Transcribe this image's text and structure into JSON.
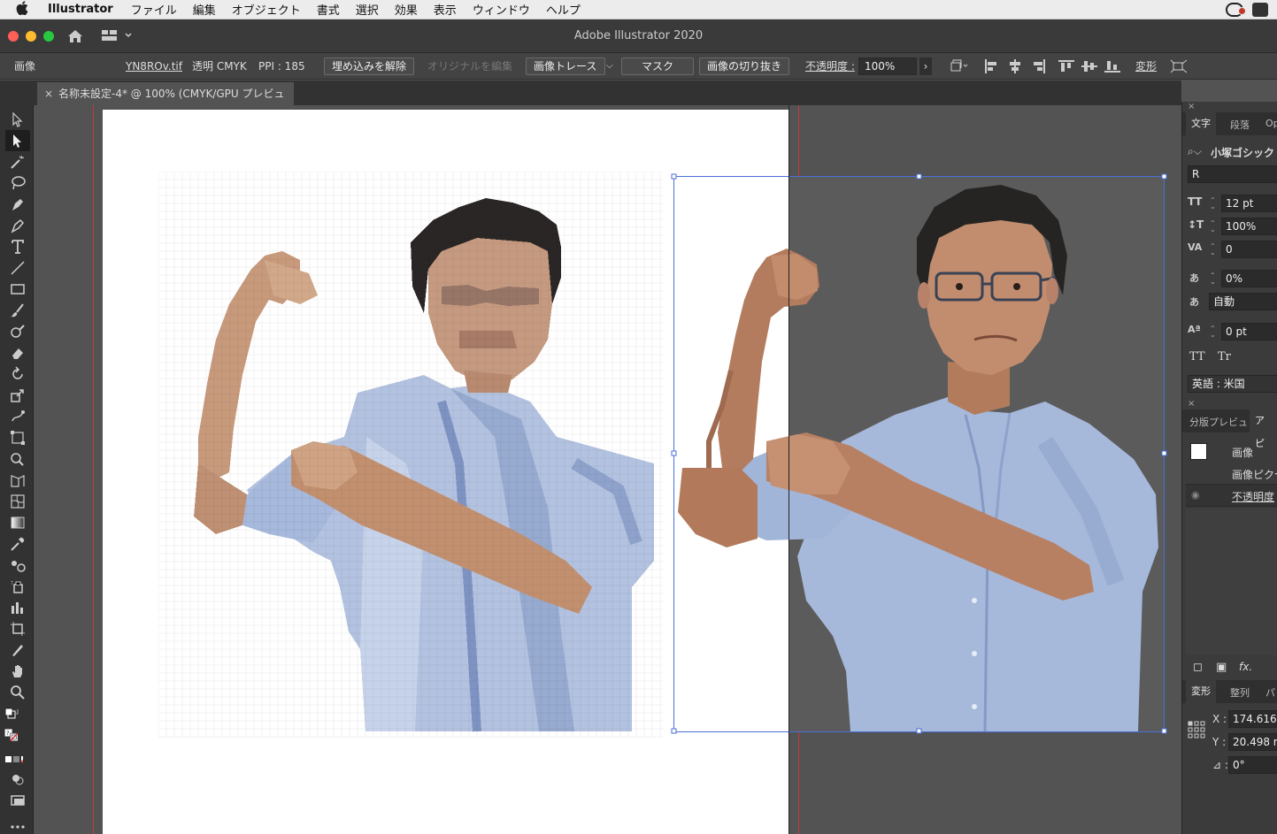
{
  "menubar": {
    "app_name": "Illustrator",
    "items": [
      "ファイル",
      "編集",
      "オブジェクト",
      "書式",
      "選択",
      "効果",
      "表示",
      "ウィンドウ",
      "ヘルプ"
    ]
  },
  "window": {
    "title": "Adobe Illustrator 2020"
  },
  "control_bar": {
    "object_type": "画像",
    "file_name": "YN8ROv.tif",
    "color_mode": "透明 CMYK",
    "ppi": "PPI : 185",
    "unembed_button": "埋め込みを解除",
    "edit_original_button": "オリジナルを編集",
    "image_trace_button": "画像トレース",
    "mask_button": "マスク",
    "crop_button": "画像の切り抜き",
    "opacity_label": "不透明度 :",
    "opacity_value": "100%",
    "transform_label": "変形"
  },
  "document_tab": {
    "close": "×",
    "label": "名称未設定-4* @ 100% (CMYK/GPU プレビュー)"
  },
  "character_panel": {
    "close": "×",
    "tabs": [
      "文字",
      "段落",
      "Op"
    ],
    "font_family": "小塚ゴシック",
    "font_style": "R",
    "font_size": "12 pt",
    "leading": "100%",
    "tracking": "0",
    "tsume": "0%",
    "aki": "自動",
    "baseline_shift": "0 pt",
    "tt_label": "TT",
    "tr_label": "Tr",
    "language": "英語 : 米国"
  },
  "appearance_panel": {
    "close": "×",
    "tabs": [
      "分版プレビュ",
      "アピ"
    ],
    "item_name": "画像",
    "item_sub": "画像ピクセ",
    "opacity_row": "不透明度",
    "fx_label": "fx."
  },
  "transform_panel": {
    "tabs": [
      "変形",
      "整列",
      "パ"
    ],
    "x_label": "X :",
    "x_value": "174.616",
    "y_label": "Y :",
    "y_value": "20.498 r",
    "angle_label": "⊿ :",
    "angle_value": "0°"
  },
  "colors": {
    "accent": "#4a6fd8",
    "bleed": "#c23b3b",
    "shirt": "#a9bcdc"
  }
}
